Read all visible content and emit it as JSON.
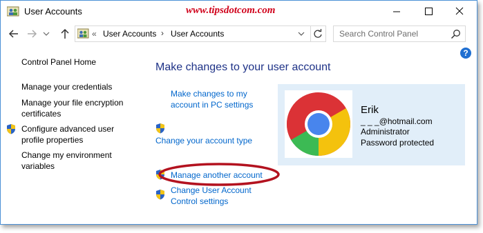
{
  "window": {
    "title": "User Accounts",
    "watermark": "www.tipsdotcom.com"
  },
  "nav": {
    "breadcrumb_prefix": "«",
    "breadcrumbs": [
      "User Accounts",
      "User Accounts"
    ],
    "breadcrumb_separator": "›",
    "search_placeholder": "Search Control Panel"
  },
  "sidebar": {
    "items": [
      {
        "label": "Control Panel Home",
        "shield": false
      },
      {
        "label": "Manage your credentials",
        "shield": false
      },
      {
        "label_lines": [
          "Manage your file encryption",
          "certificates"
        ],
        "shield": false
      },
      {
        "label_lines": [
          "Configure advanced user",
          "profile properties"
        ],
        "shield": true
      },
      {
        "label_lines": [
          "Change my environment",
          "variables"
        ],
        "shield": false
      }
    ]
  },
  "main": {
    "heading": "Make changes to your user account",
    "links": [
      {
        "label_lines": [
          "Make changes to my",
          "account in PC settings"
        ],
        "shield": false
      },
      {
        "label": "Change your account type",
        "shield": true
      },
      {
        "label": "Manage another account",
        "shield": true,
        "highlighted": true
      },
      {
        "label_lines": [
          "Change User Account",
          "Control settings"
        ],
        "shield": true
      }
    ]
  },
  "account": {
    "name": "Erik",
    "email_masked": "_ _ _@hotmail.com",
    "role": "Administrator",
    "password_status": "Password protected",
    "avatar_icon": "chrome-logo-icon"
  },
  "colors": {
    "link": "#0066cc",
    "heading": "#1e3287",
    "card_bg": "#e1eef9",
    "highlight_ring": "#b3121f",
    "watermark": "#d0021b"
  }
}
